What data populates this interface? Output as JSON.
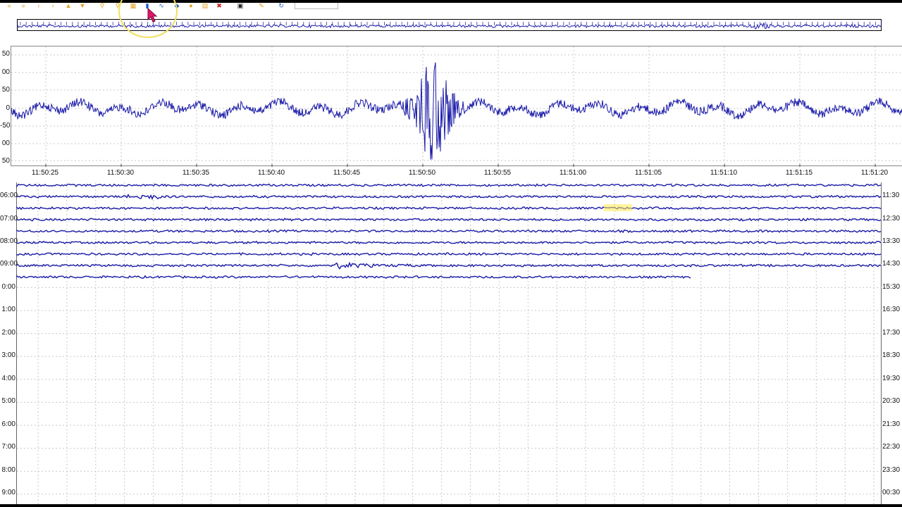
{
  "toolbar": {
    "icons": [
      "rewind-icon",
      "fast-back-icon",
      "step-back-icon",
      "back-icon",
      "up-icon",
      "down-icon",
      "zoom-in-icon",
      "zoom-out-icon",
      "table-icon",
      "bar-chart-icon",
      "line-chart-icon",
      "filter-icon",
      "marker-icon",
      "list-icon",
      "delete-icon",
      "camera-icon",
      "pencil-icon",
      "refresh-icon"
    ]
  },
  "detail": {
    "y_labels": [
      "50",
      "00",
      "50",
      "0",
      "-50",
      "00",
      "50"
    ],
    "x_labels": [
      "11:50:25",
      "11:50:30",
      "11:50:35",
      "11:50:40",
      "11:50:45",
      "11:50:50",
      "11:50:55",
      "11:51:00",
      "11:51:05",
      "11:51:10",
      "11:51:15",
      "11:51:20"
    ]
  },
  "helicorder": {
    "left_labels": [
      "06:00",
      "07:00",
      "08:00",
      "09:00",
      "0:00",
      "1:00",
      "2:00",
      "3:00",
      "4:00",
      "5:00",
      "6:00",
      "7:00",
      "8:00",
      "9:00"
    ],
    "right_labels": [
      "11:30",
      "12:30",
      "13:30",
      "14:30",
      "15:30",
      "16:30",
      "17:30",
      "18:30",
      "19:30",
      "20:30",
      "21:30",
      "22:30",
      "23:30",
      "00:30"
    ],
    "trace_count": 9,
    "last_trace_fraction": 0.78,
    "trace_color": "#1a1aa8"
  },
  "colors": {
    "trace": "#1a1aa8",
    "grid": "#c8c8c8",
    "highlight": "#f0e060"
  }
}
